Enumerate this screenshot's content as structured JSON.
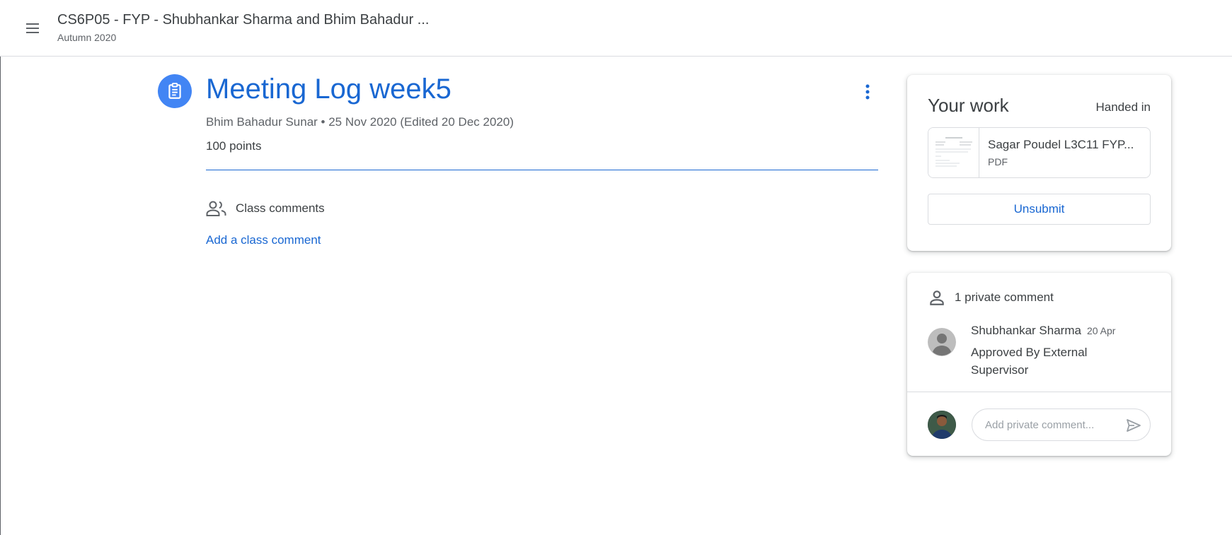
{
  "header": {
    "course_title": "CS6P05 - FYP - Shubhankar Sharma and Bhim Bahadur ...",
    "course_subtitle": "Autumn 2020"
  },
  "assignment": {
    "title": "Meeting Log week5",
    "meta": "Bhim Bahadur Sunar • 25 Nov 2020 (Edited 20 Dec 2020)",
    "points": "100 points"
  },
  "class_comments": {
    "label": "Class comments",
    "add_link": "Add a class comment"
  },
  "your_work": {
    "title": "Your work",
    "status": "Handed in",
    "attachment": {
      "name": "Sagar Poudel L3C11 FYP...",
      "type": "PDF"
    },
    "unsubmit_label": "Unsubmit"
  },
  "private_comments": {
    "header": "1 private comment",
    "comments": [
      {
        "author": "Shubhankar Sharma",
        "date": "20 Apr",
        "text": "Approved By External Supervisor"
      }
    ],
    "input_placeholder": "Add private comment..."
  },
  "colors": {
    "accent": "#1967d2",
    "icon_bg": "#4285f4",
    "divider": "#dadce0",
    "text": "#3c4043",
    "muted": "#5f6368"
  }
}
